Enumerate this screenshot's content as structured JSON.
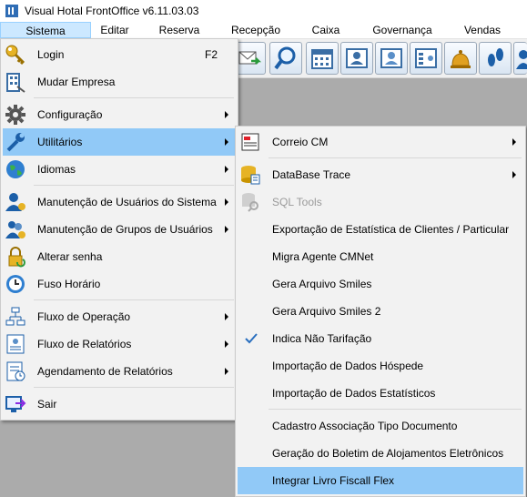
{
  "window": {
    "title": "Visual Hotal FrontOffice v6.11.03.03"
  },
  "menubar": {
    "items": [
      {
        "label": "Sistema",
        "active": true
      },
      {
        "label": "Editar"
      },
      {
        "label": "Reserva"
      },
      {
        "label": "Recepção"
      },
      {
        "label": "Caixa"
      },
      {
        "label": "Governança"
      },
      {
        "label": "Vendas"
      }
    ]
  },
  "toolbar": {
    "buttons": [
      "envelope-arrow-icon",
      "search-icon",
      "calendar-icon",
      "guest-card-icon",
      "guest-card-2-icon",
      "room-rack-icon",
      "bell-icon",
      "footprints-icon",
      "user-icon"
    ]
  },
  "sistema_menu": {
    "items": [
      {
        "label": "Login",
        "shortcut": "F2",
        "icon": "key-icon"
      },
      {
        "label": "Mudar Empresa",
        "icon": "building-icon"
      },
      {
        "label": "Configuração",
        "icon": "gear-icon",
        "submenu": true
      },
      {
        "label": "Utilitários",
        "icon": "wrench-icon",
        "submenu": true,
        "highlighted": true
      },
      {
        "label": "Idiomas",
        "icon": "globe-icon",
        "submenu": true
      },
      {
        "label": "Manutenção de Usuários do Sistema",
        "icon": "user-gear-icon",
        "submenu": true
      },
      {
        "label": "Manutenção de Grupos de Usuários",
        "icon": "users-gear-icon",
        "submenu": true
      },
      {
        "label": "Alterar senha",
        "icon": "lock-icon"
      },
      {
        "label": "Fuso Horário",
        "icon": "clock-icon"
      },
      {
        "label": "Fluxo de Operação",
        "icon": "flowchart-icon",
        "submenu": true
      },
      {
        "label": "Fluxo de Relatórios",
        "icon": "report-flow-icon",
        "submenu": true
      },
      {
        "label": "Agendamento de Relatórios",
        "icon": "report-schedule-icon",
        "submenu": true
      },
      {
        "label": "Sair",
        "icon": "exit-icon"
      }
    ]
  },
  "utilitarios_menu": {
    "items": [
      {
        "label": "Correio CM",
        "icon": "mail-doc-icon",
        "submenu": true
      },
      {
        "label": "DataBase Trace",
        "icon": "database-icon",
        "submenu": true
      },
      {
        "label": "SQL Tools",
        "icon": "database-search-icon",
        "disabled": true
      },
      {
        "label": "Exportação de Estatística de Clientes / Particular"
      },
      {
        "label": "Migra Agente CMNet"
      },
      {
        "label": "Gera Arquivo Smiles"
      },
      {
        "label": "Gera Arquivo Smiles 2"
      },
      {
        "label": "Indica Não Tarifação",
        "checked": true
      },
      {
        "label": "Importação de Dados Hóspede"
      },
      {
        "label": "Importação de Dados Estatísticos"
      },
      {
        "label": "Cadastro Associação Tipo Documento"
      },
      {
        "label": "Geração do Boletim de Alojamentos Eletrônicos"
      },
      {
        "label": "Integrar Livro Fiscall Flex",
        "highlighted": true
      }
    ]
  },
  "colors": {
    "highlight": "#91c9f7",
    "menu_bg": "#f2f2f2",
    "workspace": "#ababab"
  }
}
